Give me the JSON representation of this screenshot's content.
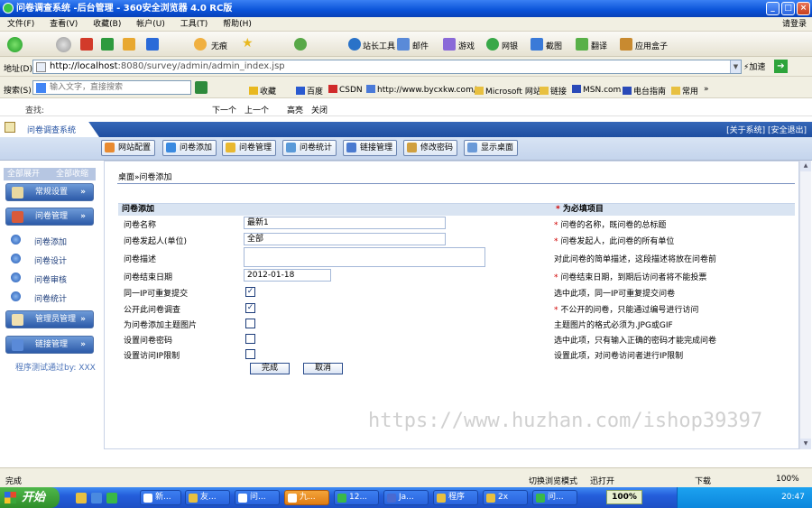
{
  "window": {
    "title": "问卷调查系统 -后台管理 - 360安全浏览器 4.0 RC版"
  },
  "menu": {
    "items": [
      "文件(F)",
      "查看(V)",
      "收藏(B)",
      "帐户(U)",
      "工具(T)",
      "帮助(H)"
    ],
    "login": "请登录"
  },
  "toolbar": {
    "nohome_label": "无痕",
    "tools": [
      "站长工具",
      "邮件",
      "游戏",
      "网银",
      "截图",
      "翻译",
      "应用盒子"
    ]
  },
  "address": {
    "label": "地址(D)",
    "url_host": "http://localhost",
    "url_rest": ":8080/survey/admin/admin_index.jsp",
    "speed_label": "加速"
  },
  "search": {
    "label": "搜索(S)",
    "placeholder": "输入文字，直接搜索"
  },
  "favorites": [
    "收藏",
    "百度",
    "CSDN",
    "http://www.bycxkw.com/",
    "Microsoft 网站",
    "链接",
    "MSN.com",
    "电台指南",
    "常用"
  ],
  "findbar": {
    "label": "查找:",
    "next": "下一个",
    "prev": "上一个",
    "highlight": "高亮",
    "close": "关闭"
  },
  "app": {
    "title": "问卷调查系统",
    "links": "[关于系统] [安全退出]"
  },
  "nav_tabs": [
    "网站配置",
    "问卷添加",
    "问卷管理",
    "问卷统计",
    "链接管理",
    "修改密码",
    "显示桌面"
  ],
  "sidebar": {
    "expand": "全部展开",
    "collapse": "全部收缩",
    "group_common": "常规设置",
    "group_survey": "问卷管理",
    "items": [
      "问卷添加",
      "问卷设计",
      "问卷审核",
      "问卷统计"
    ],
    "group_admin": "管理员管理",
    "group_links": "链接管理",
    "footer": "程序测试通过by: XXX"
  },
  "breadcrumb": "桌面»问卷添加",
  "form": {
    "header": "问卷添加",
    "required_note": "为必填项目",
    "rows": [
      {
        "label": "问卷名称",
        "value": "最新1",
        "hint": "问卷的名称，既问卷的总标题"
      },
      {
        "label": "问卷发起人(单位)",
        "value": "全部",
        "hint": "问卷发起人，此问卷的所有单位"
      },
      {
        "label": "问卷描述",
        "value": "",
        "hint": "对此问卷的简单描述，这段描述将放在问卷前"
      },
      {
        "label": "问卷结束日期",
        "value": "2012-01-18",
        "hint": "问卷结束日期，到期后访问者将不能投票"
      },
      {
        "label": "同一IP可重复提交",
        "checked": true,
        "hint": "选中此项，同一IP可重复提交问卷"
      },
      {
        "label": "公开此问卷调查",
        "checked": true,
        "hint": "不公开的问卷，只能通过编号进行访问"
      },
      {
        "label": "为问卷添加主题图片",
        "checked": false,
        "hint": "主题图片的格式必须为.JPG或GIF"
      },
      {
        "label": "设置问卷密码",
        "checked": false,
        "hint": "选中此项，只有输入正确的密码才能完成问卷"
      },
      {
        "label": "设置访问IP限制",
        "checked": false,
        "hint": "设置此项，对问卷访问者进行IP限制"
      }
    ],
    "submit": "完成",
    "cancel": "取消"
  },
  "watermark": "https://www.huzhan.com/ishop39397",
  "status": {
    "text": "完成",
    "compat": "切换浏览模式",
    "thunder": "迅打开",
    "download": "下载",
    "zoom": "100%"
  },
  "taskbar": {
    "start": "开始",
    "tasks": [
      "新...",
      "友...",
      "问...",
      "九...",
      "12...",
      "Ja...",
      "程序",
      "2x",
      "问..."
    ],
    "battery": "100%",
    "clock": "20:47"
  }
}
